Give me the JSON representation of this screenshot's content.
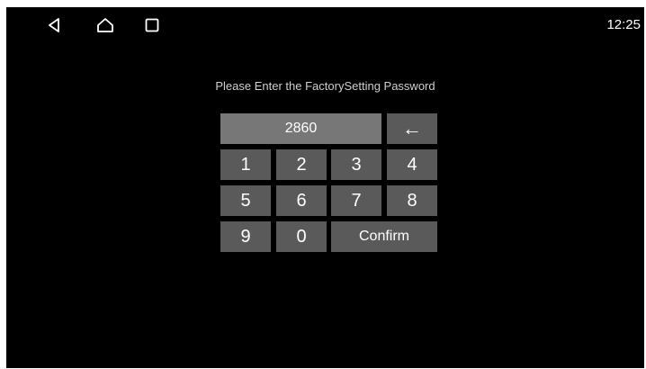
{
  "status_bar": {
    "time": "12:25"
  },
  "nav": {
    "back_icon": "back-triangle-icon",
    "home_icon": "home-icon",
    "recent_icon": "recent-apps-icon"
  },
  "dialog": {
    "prompt": "Please Enter the FactorySetting Password",
    "password_value": "2860"
  },
  "keypad": {
    "backspace_symbol": "←",
    "keys": {
      "k1": "1",
      "k2": "2",
      "k3": "3",
      "k4": "4",
      "k5": "5",
      "k6": "6",
      "k7": "7",
      "k8": "8",
      "k9": "9",
      "k0": "0"
    },
    "confirm_label": "Confirm"
  },
  "colors": {
    "background": "#000000",
    "key_bg": "#5a5a5a",
    "display_bg": "#777777",
    "text": "#ffffff"
  }
}
